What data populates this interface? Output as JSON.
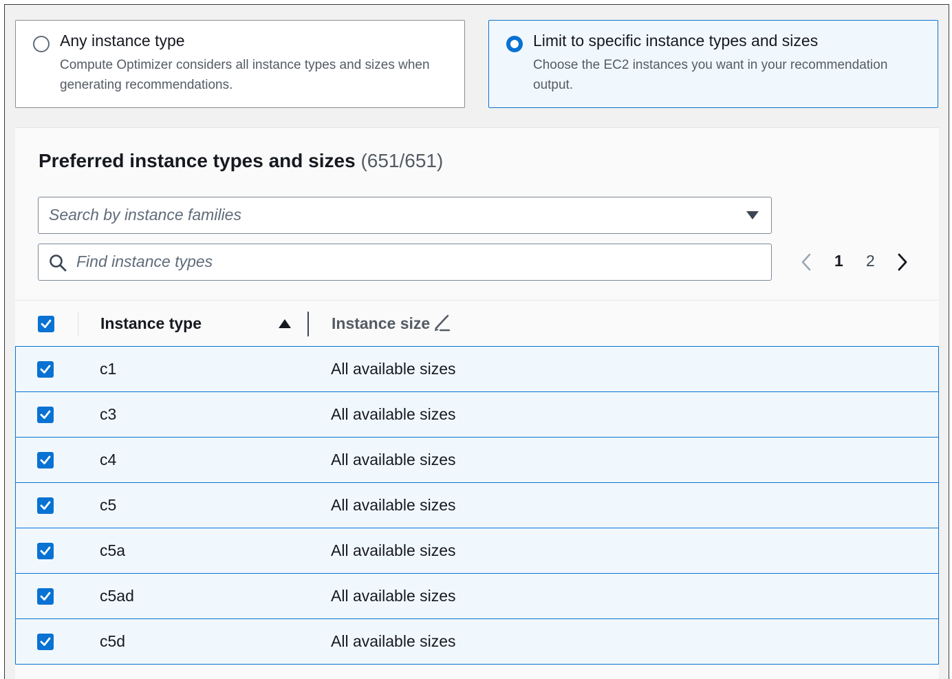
{
  "options": [
    {
      "title": "Any instance type",
      "description": "Compute Optimizer considers all instance types and sizes when generating recommendations.",
      "selected": false
    },
    {
      "title": "Limit to specific instance types and sizes",
      "description": "Choose the EC2 instances you want in your recommendation output.",
      "selected": true
    }
  ],
  "panel": {
    "title": "Preferred instance types and sizes",
    "count": "(651/651)"
  },
  "family_select": {
    "placeholder": "Search by instance families"
  },
  "find_input": {
    "placeholder": "Find instance types"
  },
  "pagination": {
    "pages": [
      "1",
      "2"
    ],
    "current": "1"
  },
  "table": {
    "columns": {
      "type": "Instance type",
      "size": "Instance size"
    },
    "rows": [
      {
        "type": "c1",
        "size": "All available sizes",
        "checked": true
      },
      {
        "type": "c3",
        "size": "All available sizes",
        "checked": true
      },
      {
        "type": "c4",
        "size": "All available sizes",
        "checked": true
      },
      {
        "type": "c5",
        "size": "All available sizes",
        "checked": true
      },
      {
        "type": "c5a",
        "size": "All available sizes",
        "checked": true
      },
      {
        "type": "c5ad",
        "size": "All available sizes",
        "checked": true
      },
      {
        "type": "c5d",
        "size": "All available sizes",
        "checked": true
      }
    ]
  },
  "colors": {
    "accent": "#0972d3",
    "selected_bg": "#f1f8fd",
    "text": "#16191f",
    "secondary_text": "#545b64"
  }
}
